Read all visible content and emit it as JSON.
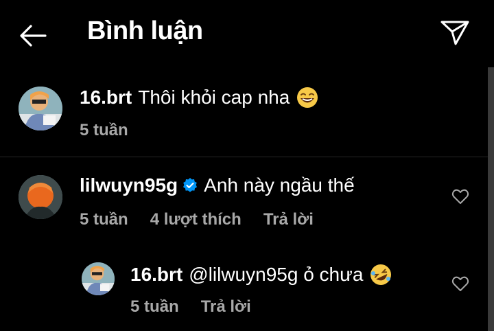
{
  "header": {
    "title": "Bình luận"
  },
  "comments": [
    {
      "user": "16.brt",
      "text": "Thôi khỏi cap nha",
      "time": "5 tuần"
    },
    {
      "user": "lilwuyn95g",
      "text": "Anh này ngầu thế",
      "time": "5 tuần",
      "likes": "4 lượt thích",
      "reply": "Trả lời"
    }
  ],
  "reply": {
    "user": "16.brt",
    "text": "@lilwuyn95g ỏ chưa",
    "time": "5 tuần",
    "reply_label": "Trả lời"
  },
  "icons": [
    "back-arrow-icon",
    "send-icon",
    "verified-badge-icon",
    "heart-icon",
    "laughing-emoji-icon",
    "rofl-emoji-icon"
  ],
  "colors": {
    "background": "#000000",
    "text": "#ffffff",
    "muted": "#a8a8a8",
    "verified": "#0095f6"
  }
}
